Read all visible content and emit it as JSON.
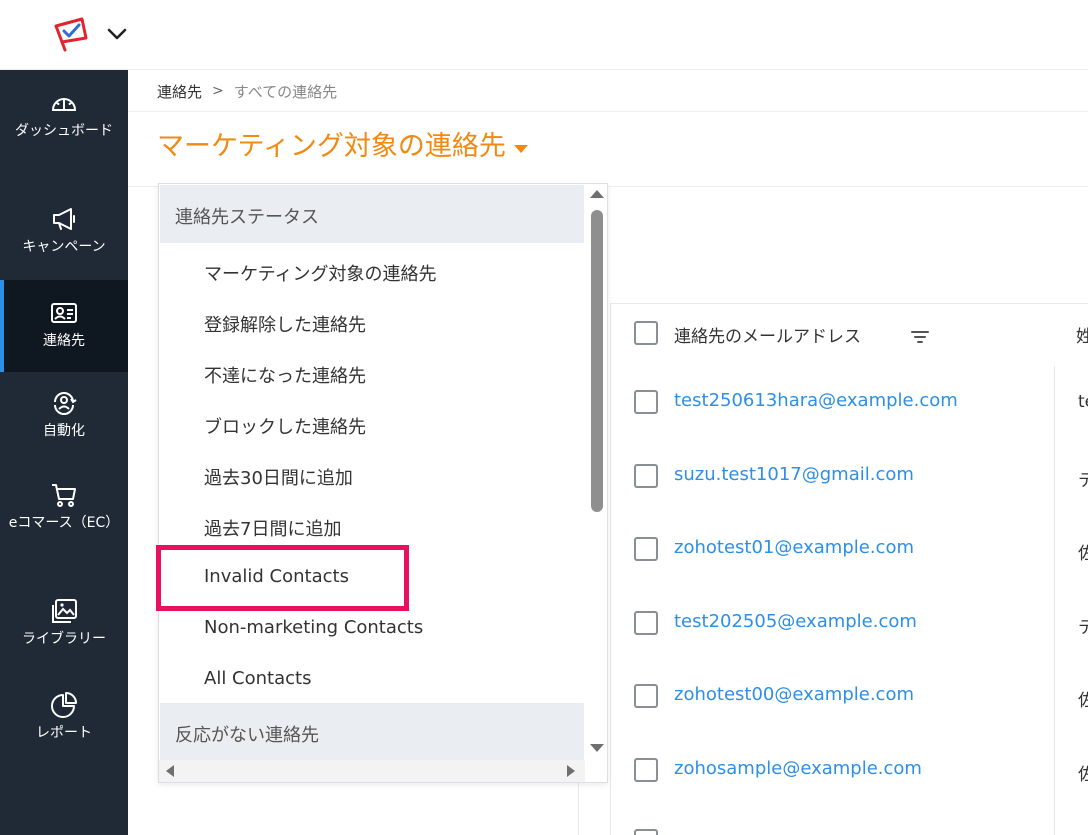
{
  "app": {
    "logo_icon": "megaphone-logo-icon",
    "menu_icon": "chevron-down-icon",
    "colors": {
      "accent": "#f08a13",
      "link": "#2c8fe8",
      "sidebar": "#1f2a36",
      "highlight": "#e8105f"
    }
  },
  "sidebar": {
    "items": [
      {
        "icon": "gauge-icon",
        "label": "ダッシュボード",
        "active": false
      },
      {
        "icon": "megaphone-icon",
        "label": "キャンペーン",
        "active": false
      },
      {
        "icon": "contact-card-icon",
        "label": "連絡先",
        "active": true
      },
      {
        "icon": "automation-icon",
        "label": "自動化",
        "active": false
      },
      {
        "icon": "cart-icon",
        "label": "eコマース（EC）",
        "active": false
      },
      {
        "icon": "image-library-icon",
        "label": "ライブラリー",
        "active": false
      },
      {
        "icon": "pie-chart-icon",
        "label": "レポート",
        "active": false
      }
    ]
  },
  "breadcrumb": {
    "root": "連絡先",
    "separator": ">",
    "current": "すべての連絡先"
  },
  "page": {
    "title": "マーケティング対象の連絡先"
  },
  "dropdown": {
    "group1": "連絡先ステータス",
    "items": [
      "マーケティング対象の連絡先",
      "登録解除した連絡先",
      "不達になった連絡先",
      "ブロックした連絡先",
      "過去30日間に追加",
      "過去7日間に追加",
      "Invalid Contacts",
      "Non-marketing Contacts",
      "All Contacts"
    ],
    "group2": "反応がない連絡先"
  },
  "table": {
    "header_email": "連絡先のメールアドレス",
    "header_next": "姓",
    "rows": [
      {
        "email": "test250613hara@example.com",
        "name": "te"
      },
      {
        "email": "suzu.test1017@gmail.com",
        "name": "テ"
      },
      {
        "email": "zohotest01@example.com",
        "name": "佐"
      },
      {
        "email": "test202505@example.com",
        "name": "テ"
      },
      {
        "email": "zohotest00@example.com",
        "name": "佐"
      },
      {
        "email": "zohosample@example.com",
        "name": "佐"
      }
    ]
  }
}
